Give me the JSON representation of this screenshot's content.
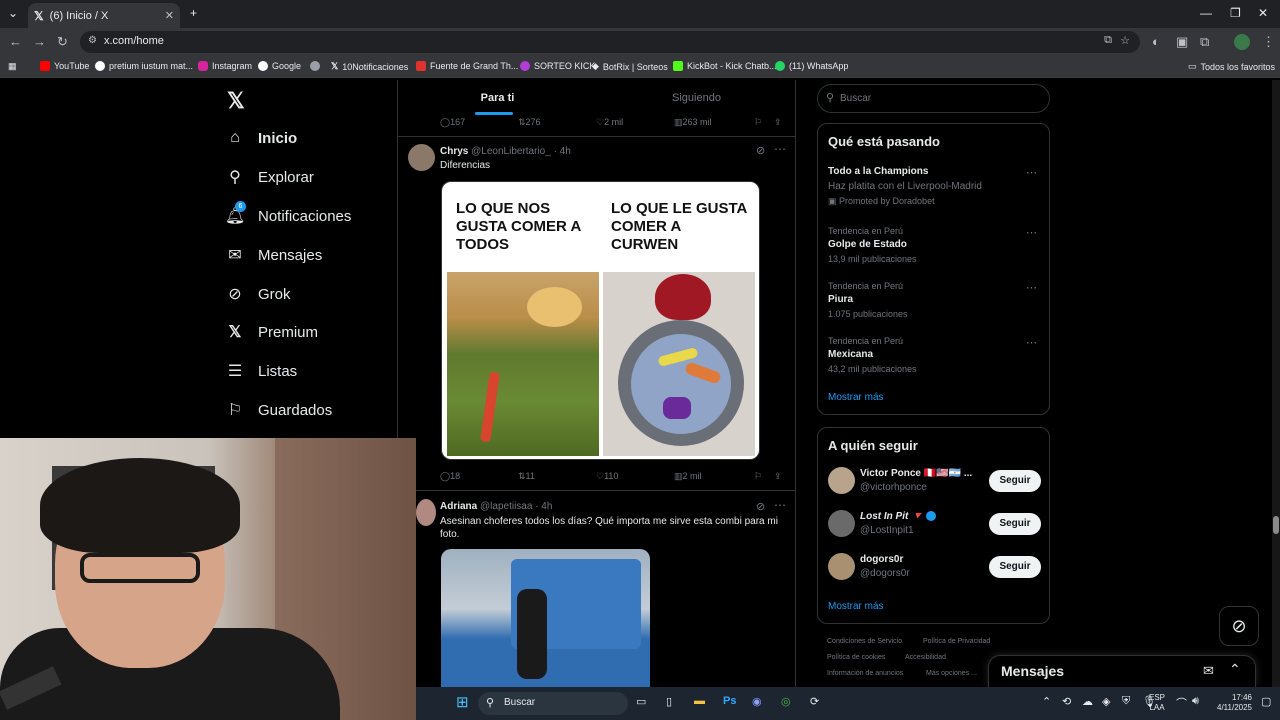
{
  "browser": {
    "tab_title": "(6) Inicio / X",
    "url": "x.com/home",
    "bookmarks": [
      "YouTube",
      "pretium iustum mat...",
      "Instagram",
      "Google",
      "10Notificaciones",
      "Fuente de Grand Th...",
      "SORTEO KICK",
      "BotRix | Sorteos",
      "KickBot - Kick Chatb...",
      "(11) WhatsApp"
    ],
    "all_bookmarks": "Todos los favoritos"
  },
  "sidebar": {
    "badge": "6",
    "items": [
      {
        "label": "Inicio",
        "icon": "home-icon"
      },
      {
        "label": "Explorar",
        "icon": "search-icon"
      },
      {
        "label": "Notificaciones",
        "icon": "bell-icon"
      },
      {
        "label": "Mensajes",
        "icon": "envelope-icon"
      },
      {
        "label": "Grok",
        "icon": "grok-icon"
      },
      {
        "label": "Premium",
        "icon": "x-logo-icon"
      },
      {
        "label": "Listas",
        "icon": "list-icon"
      },
      {
        "label": "Guardados",
        "icon": "bookmark-icon"
      }
    ]
  },
  "timeline": {
    "tabs": [
      "Para ti",
      "Siguiendo"
    ],
    "prev_actions": {
      "replies": "167",
      "reposts": "276",
      "likes": "2 mil",
      "views": "263 mil"
    },
    "tweet1": {
      "name": "Chrys",
      "handle": "@LeonLibertario_ · 4h",
      "text": "Diferencias",
      "meme_left": "LO QUE NOS GUSTA COMER A TODOS",
      "meme_right": "LO QUE LE GUSTA COMER A CURWEN",
      "actions": {
        "replies": "18",
        "reposts": "11",
        "likes": "110",
        "views": "2 mil"
      }
    },
    "tweet2": {
      "name": "Adriana",
      "handle": "@lapetiisaa · 4h",
      "text": "Asesinan choferes todos los días? Qué importa me sirve esta combi para mi foto."
    }
  },
  "right": {
    "search_placeholder": "Buscar",
    "trends_title": "Qué está pasando",
    "promo": {
      "name": "Todo a la Champions",
      "desc": "Haz platita con el Liverpool-Madrid",
      "by": "Promoted by Doradobet"
    },
    "trends": [
      {
        "context": "Tendencia en Perú",
        "name": "Golpe de Estado",
        "count": "13,9 mil publicaciones"
      },
      {
        "context": "Tendencia en Perú",
        "name": "Piura",
        "count": "1.075 publicaciones"
      },
      {
        "context": "Tendencia en Perú",
        "name": "Mexicana",
        "count": "43,2 mil publicaciones"
      }
    ],
    "show_more": "Mostrar más",
    "follow_title": "A quién seguir",
    "follow": [
      {
        "name": "Victor Ponce 🇵🇪🇺🇸🇦🇷 ...",
        "handle": "@victorhponce",
        "button": "Seguir"
      },
      {
        "name": "Lost In Pit 🔻",
        "handle": "@LostInpit1",
        "button": "Seguir"
      },
      {
        "name": "dogors0r",
        "handle": "@dogors0r",
        "button": "Seguir"
      }
    ],
    "footer": [
      "Condiciones de Servicio",
      "Política de Privacidad",
      "Política de cookies",
      "Accesibilidad",
      "Información de anuncios",
      "Más opciones ..."
    ],
    "messages": "Mensajes"
  },
  "taskbar": {
    "search": "Buscar",
    "lang": "ESP",
    "lang2": "LAA",
    "time": "17:46",
    "date": "4/11/2025"
  }
}
